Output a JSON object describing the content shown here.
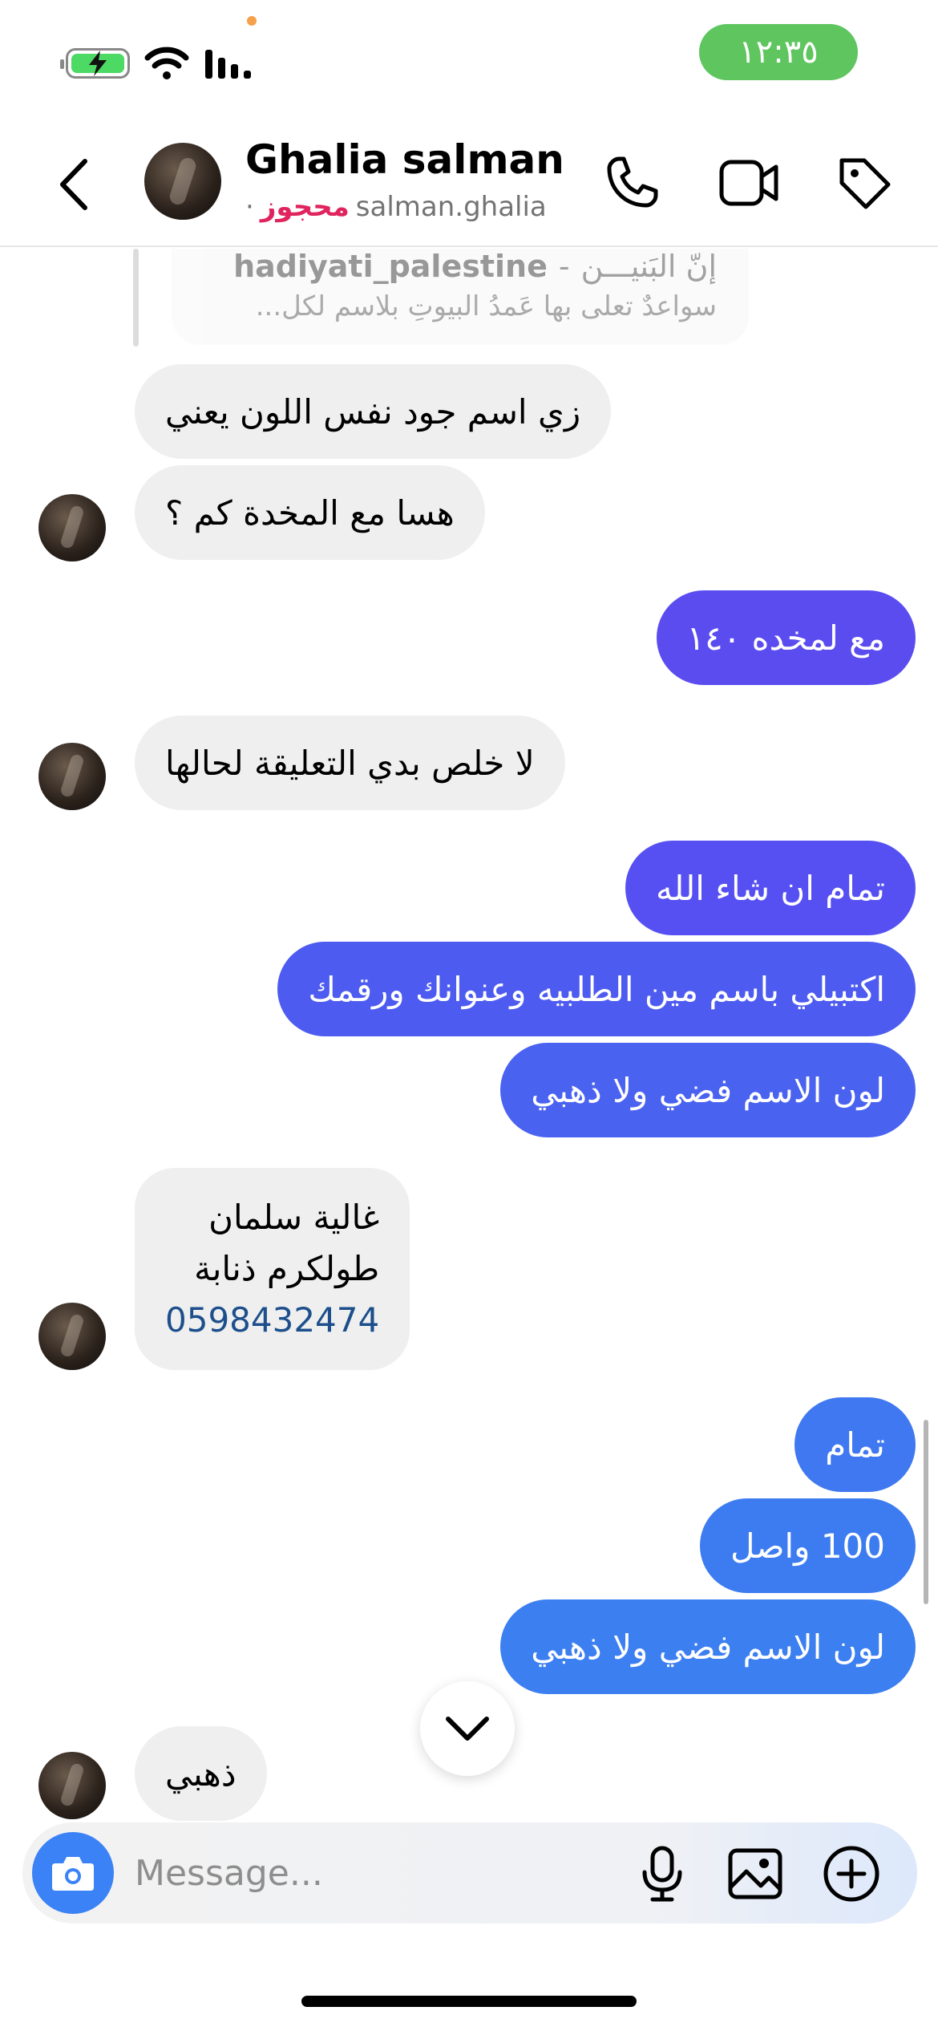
{
  "status_bar": {
    "time": "١٢:٣٥",
    "colors": {
      "time_pill": "#5ec55f",
      "battery": "#4cd964",
      "dot": "#f5a04b"
    }
  },
  "header": {
    "name": "Ghalia salman",
    "username": "salman.ghalia",
    "blocked_label": "محجوز",
    "separator": "·"
  },
  "reply_preview": {
    "account": "hadiyati_palestine",
    "dash": "-",
    "line1": "إنّ البَنيـــن",
    "line2": "سواعدٌ تعلى بها عَمدُ البيوتِ بلاسم لكل..."
  },
  "messages": [
    {
      "dir": "in",
      "text": "زي اسم جود نفس اللون يعني"
    },
    {
      "dir": "in",
      "text": "هسا مع المخدة كم  ؟"
    },
    {
      "dir": "out",
      "text": "مع لمخده ١٤٠"
    },
    {
      "dir": "in",
      "text": "لا خلص بدي التعليقة لحالها"
    },
    {
      "dir": "out",
      "text": "تمام ان شاء الله"
    },
    {
      "dir": "out",
      "text": "اكتبيلي باسم مين الطلبيه وعنوانك ورقمك"
    },
    {
      "dir": "out",
      "text": "لون الاسم فضي ولا ذهبي"
    },
    {
      "dir": "in",
      "lines": [
        "غالية سلمان",
        "طولكرم ذنابة"
      ],
      "phone": "0598432474"
    },
    {
      "dir": "out",
      "text": "تمام"
    },
    {
      "dir": "out",
      "text": "100 واصل"
    },
    {
      "dir": "out",
      "text": "لون الاسم فضي ولا ذهبي"
    },
    {
      "dir": "in",
      "text": "ذهبي"
    }
  ],
  "composer": {
    "placeholder": "Message..."
  },
  "colors": {
    "incoming_bubble": "#efefef",
    "outgoing_purple": "#5b4cf0",
    "outgoing_indigo": "#4d5bf0",
    "outgoing_blue": "#3b7ff0",
    "camera_button": "#3b82f6",
    "blocked": "#e0245e"
  },
  "icons": [
    "back-icon",
    "phone-icon",
    "video-icon",
    "tag-icon",
    "camera-icon",
    "microphone-icon",
    "gallery-icon",
    "plus-icon",
    "chevron-down-icon",
    "wifi-icon",
    "signal-icon",
    "battery-icon"
  ]
}
